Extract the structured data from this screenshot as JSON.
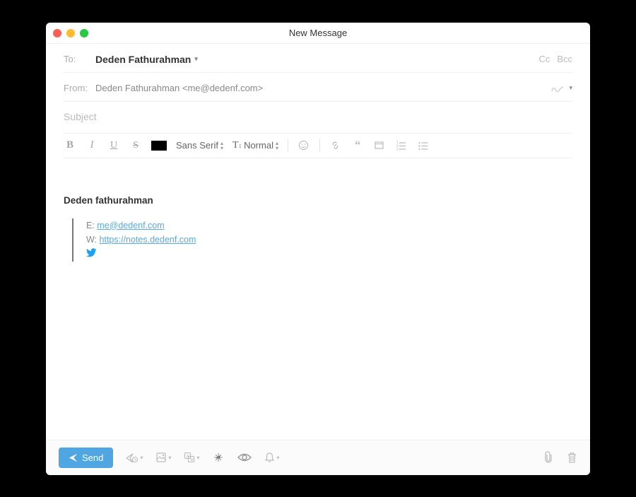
{
  "window": {
    "title": "New Message"
  },
  "header": {
    "to_label": "To:",
    "recipient": "Deden Fathurahman",
    "cc": "Cc",
    "bcc": "Bcc",
    "from_label": "From:",
    "from_value": "Deden Fathurahman <me@dedenf.com>",
    "subject_placeholder": "Subject"
  },
  "toolbar": {
    "bold": "B",
    "italic": "I",
    "underline": "U",
    "strike": "S",
    "font_family": "Sans Serif",
    "size_icon": "T",
    "size_label": "Normal"
  },
  "signature": {
    "name": "Deden fathurahman",
    "email_prefix": "E: ",
    "email": "me@dedenf.com",
    "web_prefix": "W: ",
    "web": "https://notes.dedenf.com"
  },
  "footer": {
    "send": "Send"
  }
}
